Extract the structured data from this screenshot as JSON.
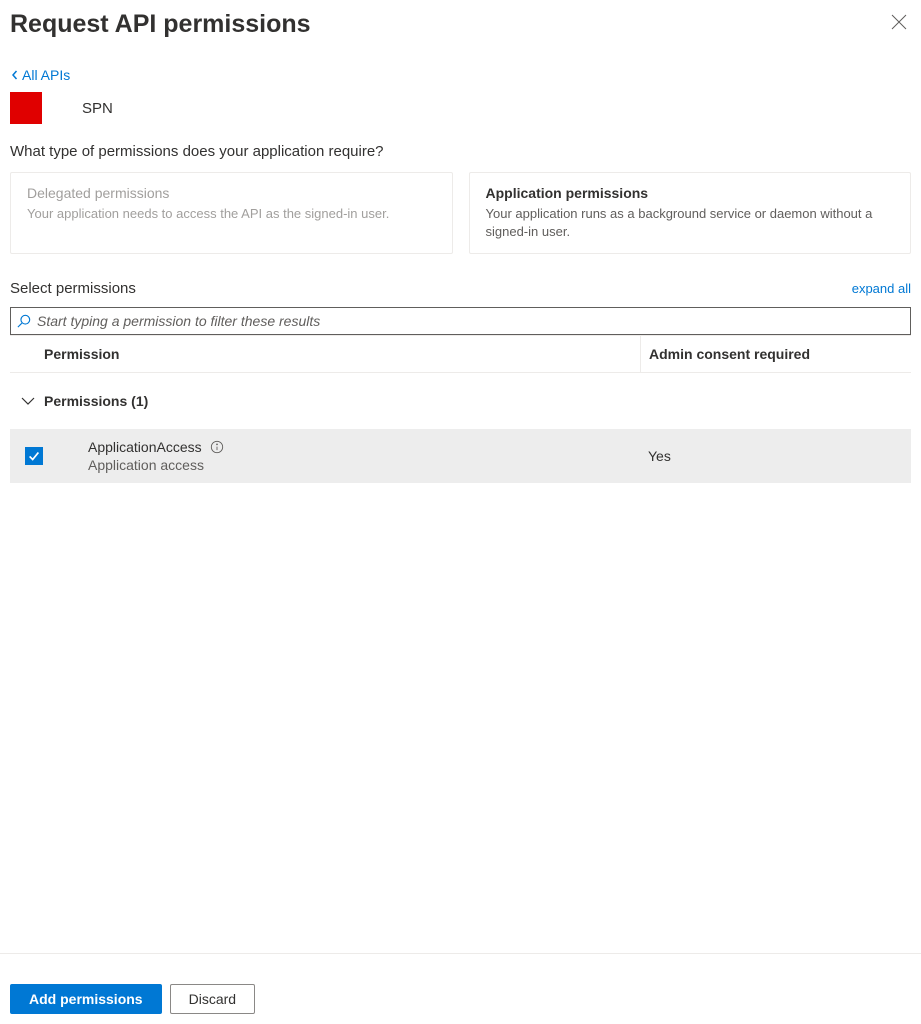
{
  "header": {
    "title": "Request API permissions"
  },
  "navigation": {
    "back_link": "All APIs"
  },
  "api": {
    "name": "SPN"
  },
  "question": "What type of permissions does your application require?",
  "permission_types": {
    "delegated": {
      "title": "Delegated permissions",
      "description": "Your application needs to access the API as the signed-in user."
    },
    "application": {
      "title": "Application permissions",
      "description": "Your application runs as a background service or daemon without a signed-in user."
    }
  },
  "select_section": {
    "title": "Select permissions",
    "expand_all": "expand all"
  },
  "search": {
    "placeholder": "Start typing a permission to filter these results"
  },
  "table": {
    "headers": {
      "permission": "Permission",
      "consent": "Admin consent required"
    },
    "group_label": "Permissions (1)",
    "rows": [
      {
        "name": "ApplicationAccess",
        "description": "Application access",
        "consent": "Yes",
        "checked": true
      }
    ]
  },
  "footer": {
    "primary": "Add permissions",
    "secondary": "Discard"
  }
}
